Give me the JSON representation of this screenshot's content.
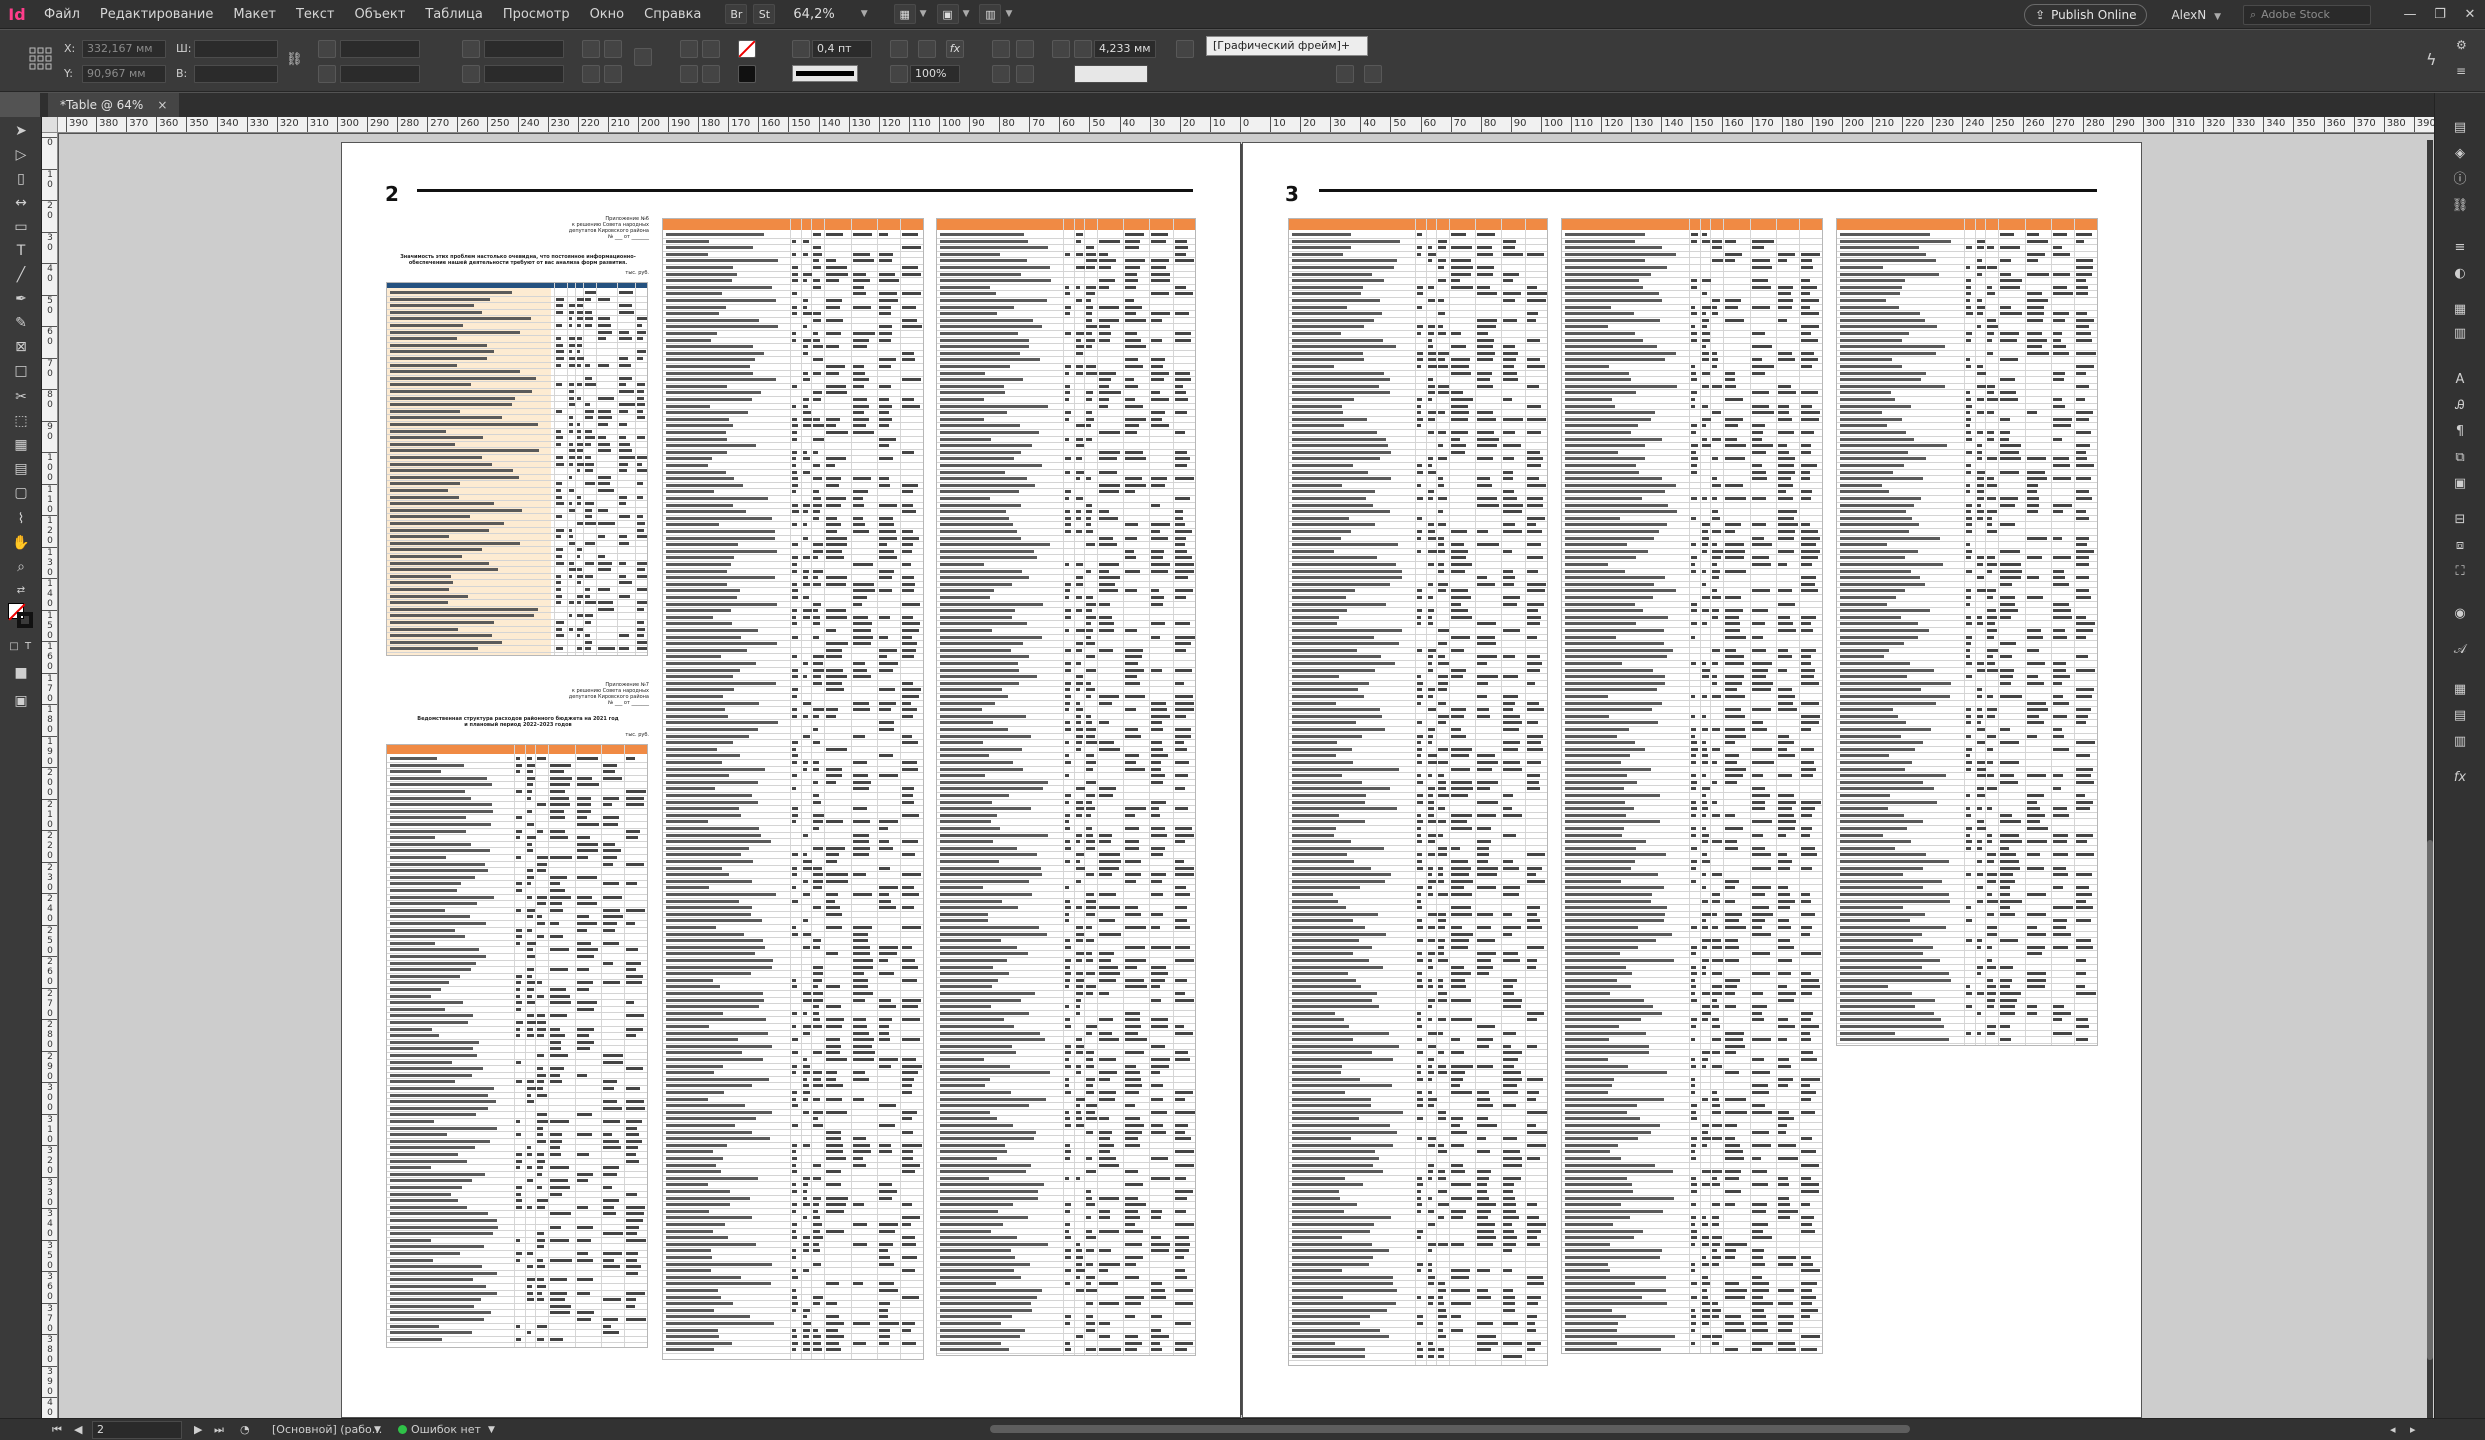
{
  "app": {
    "logo": "Id"
  },
  "menu": [
    "Файл",
    "Редактирование",
    "Макет",
    "Текст",
    "Объект",
    "Таблица",
    "Просмотр",
    "Окно",
    "Справка"
  ],
  "menubar": {
    "bridge": "Br",
    "stock": "St",
    "zoom": "64,2%",
    "publish": "Publish Online",
    "user": "AlexN",
    "search_placeholder": "Adobe Stock",
    "minimize": "—",
    "restore": "❐",
    "close": "✕"
  },
  "control": {
    "x_label": "X:",
    "x_value": "332,167 мм",
    "y_label": "Y:",
    "y_value": "90,967 мм",
    "w_label": "Ш:",
    "h_label": "В:",
    "stroke_weight": "0,4 пт",
    "scale": "100%",
    "offset": "4,233 мм",
    "frame_style": "[Графический фрейм]+"
  },
  "document": {
    "tab_label": "*Table @ 64%",
    "tab_close": "×",
    "page_left_number": "2",
    "page_right_number": "3"
  },
  "ruler_labels": [
    "390",
    "380",
    "370",
    "360",
    "350",
    "340",
    "330",
    "320",
    "310",
    "300",
    "290",
    "280",
    "270",
    "260",
    "250",
    "240",
    "230",
    "220",
    "210",
    "200",
    "190",
    "180",
    "170",
    "160",
    "150",
    "140",
    "130",
    "120",
    "110",
    "100",
    "90",
    "80",
    "70",
    "60",
    "50",
    "40",
    "30",
    "20",
    "10",
    "0",
    "10",
    "20",
    "30",
    "40",
    "50",
    "60",
    "70",
    "80",
    "90",
    "100",
    "110",
    "120",
    "130",
    "140",
    "150",
    "160",
    "170",
    "180",
    "190",
    "200",
    "210",
    "220",
    "230",
    "240",
    "250",
    "260",
    "270",
    "280",
    "290",
    "300",
    "310",
    "320",
    "330",
    "340",
    "350",
    "360",
    "370",
    "380",
    "390"
  ],
  "vruler_labels": [
    "0",
    "1 0",
    "2 0",
    "3 0",
    "4 0",
    "5 0",
    "6 0",
    "7 0",
    "8 0",
    "9 0",
    "1 0 0",
    "1 1 0",
    "1 2 0",
    "1 3 0",
    "1 4 0",
    "1 5 0",
    "1 6 0",
    "1 7 0",
    "1 8 0",
    "1 9 0",
    "2 0 0",
    "2 1 0",
    "2 2 0",
    "2 3 0",
    "2 4 0",
    "2 5 0",
    "2 6 0",
    "2 7 0",
    "2 8 0",
    "2 9 0",
    "3 0 0",
    "3 1 0",
    "3 2 0",
    "3 3 0",
    "3 4 0",
    "3 5 0",
    "3 6 0",
    "3 7 0",
    "3 8 0",
    "3 9 0",
    "4 0 0"
  ],
  "captions": {
    "app6_title": "Приложение №6\nк решению Совета народных\nдепутатов Кировского района\n№ ___ от _______",
    "app6_heading": "Значимость этих проблем настолько очевидна, что постоянное информационно-\nобеспечение нашей деятельности требуют от вас анализа форм развития.",
    "app6_unit": "тыс. руб.",
    "app7_title": "Приложение №7\nк решению Совета народных\nдепутатов Кировского района\n№ ___ от _______",
    "app7_heading": "Ведомственная структура расходов районного бюджета на 2021 год\nи плановый период 2022–2023 годов",
    "app7_unit": "тыс. руб."
  },
  "status": {
    "page": "2",
    "master": "[Основной] (рабо...",
    "errors": "Ошибок нет"
  },
  "colors": {
    "accent_orange": "#f08a44",
    "cream_fill": "#fdebd2",
    "header_blue": "#25517f"
  }
}
